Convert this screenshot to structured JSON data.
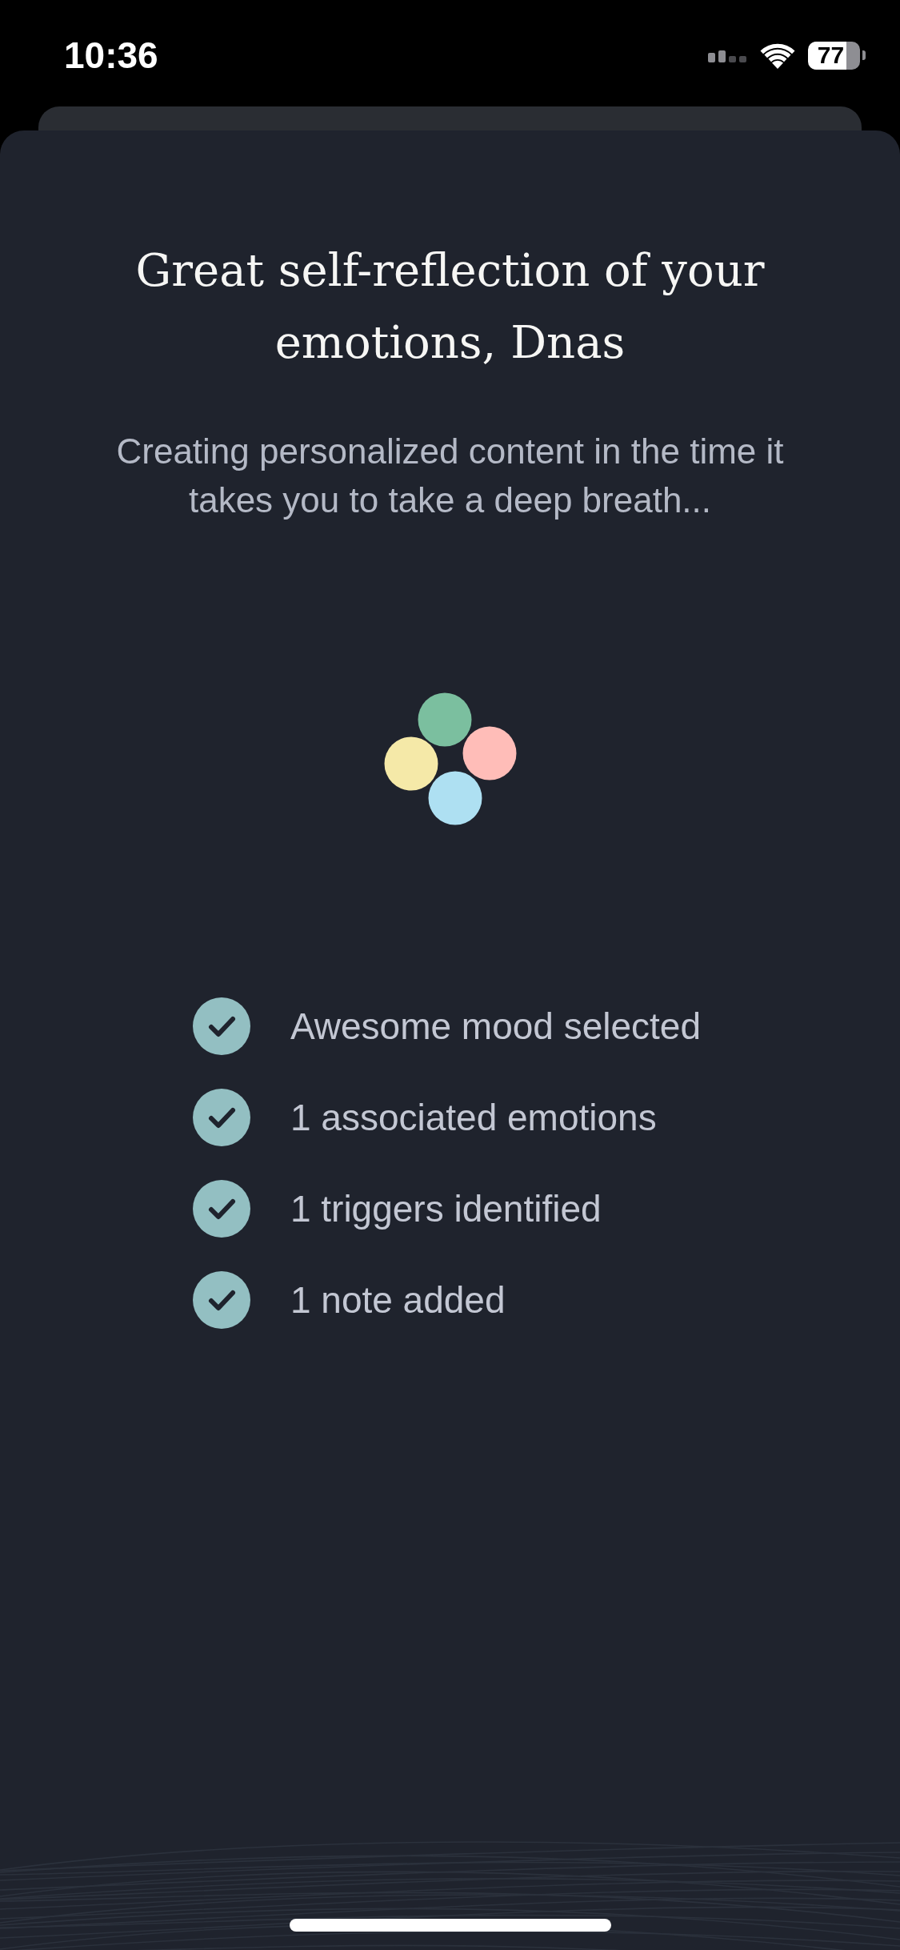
{
  "status_bar": {
    "time": "10:36",
    "battery": "77"
  },
  "title": "Great self-reflection of your emotions, Dnas",
  "subtitle": "Creating personalized content in the time it takes you to take a deep breath...",
  "loader": {
    "dots": [
      {
        "color": "#7bbf9f"
      },
      {
        "color": "#ffbdb8"
      },
      {
        "color": "#f5e9a8"
      },
      {
        "color": "#aee0f2"
      }
    ]
  },
  "checklist": [
    {
      "label": "Awesome mood selected",
      "checked": true
    },
    {
      "label": "1 associated emotions",
      "checked": true
    },
    {
      "label": "1 triggers identified",
      "checked": true
    },
    {
      "label": "1 note added",
      "checked": true
    }
  ]
}
